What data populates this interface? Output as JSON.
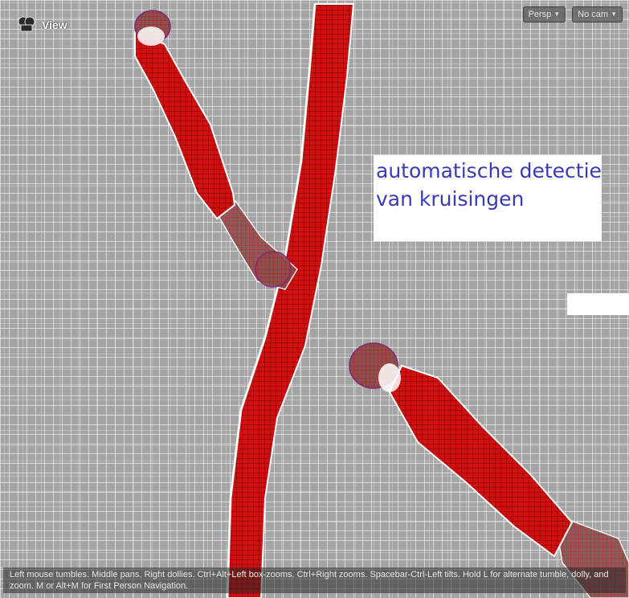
{
  "viewport": {
    "view_label": "View",
    "view_icon": "camera-cube-icon",
    "projection_dropdown": "Persp",
    "camera_dropdown": "No cam"
  },
  "annotation": {
    "line1": "automatische detectie",
    "line2": "van kruisingen"
  },
  "status_bar": {
    "text": "Left mouse tumbles. Middle pans. Right dollies. Ctrl+Alt+Left box-zooms. Ctrl+Right zooms. Spacebar-Ctrl-Left tilts. Hold L for alternate tumble, dolly, and zoom. M or Alt+M for First Person Navigation."
  },
  "colors": {
    "background": "#a4a4a4",
    "mesh_lines": "#ffffff",
    "tube_fill": "#d81010",
    "annotation_text": "#3a3ab8"
  }
}
